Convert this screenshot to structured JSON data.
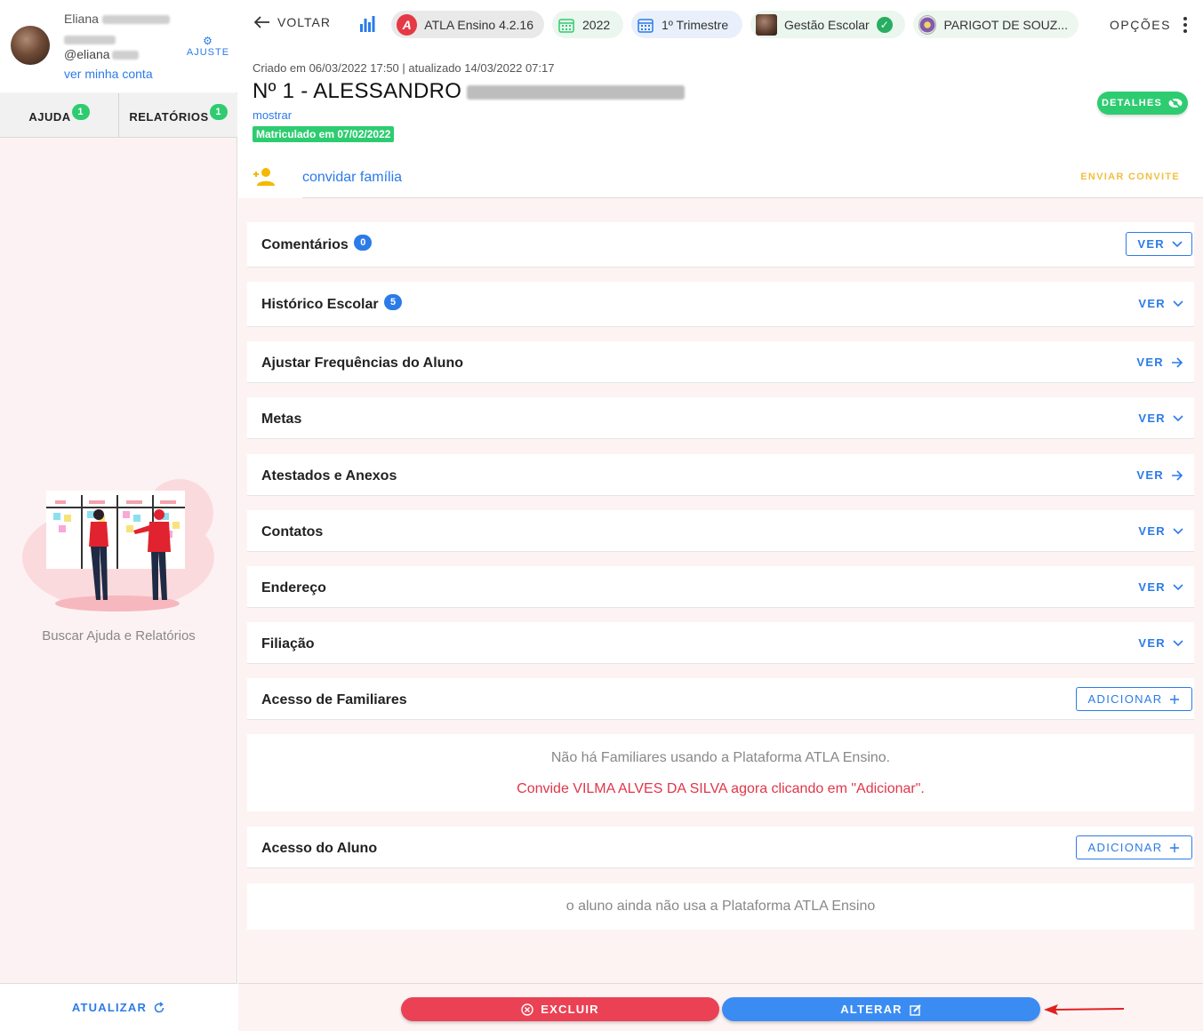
{
  "sidebar": {
    "user": {
      "name": "Eliana",
      "handle": "@eliana",
      "my_account_link": "ver minha conta",
      "adjust_label": "AJUSTE"
    },
    "tabs": [
      {
        "label": "AJUDA",
        "badge": "1"
      },
      {
        "label": "RELATÓRIOS",
        "badge": "1"
      }
    ],
    "help_caption": "Buscar Ajuda e Relatórios",
    "update_label": "ATUALIZAR"
  },
  "topbar": {
    "back_label": "VOLTAR",
    "app_chip": "ATLA Ensino 4.2.16",
    "year_chip": "2022",
    "term_chip": "1º Trimestre",
    "system_chip": "Gestão Escolar",
    "school_chip": "PARIGOT DE SOUZ...",
    "options_label": "OPÇÕES"
  },
  "student": {
    "meta": "Criado em 06/03/2022 17:50 | atualizado 14/03/2022 07:17",
    "title": "Nº 1 - ALESSANDRO",
    "show_link": "mostrar",
    "enrolled": "Matriculado em 07/02/2022",
    "details_label": "DETALHES",
    "invite_family": "convidar família",
    "send_invite": "ENVIAR CONVITE"
  },
  "sections": [
    {
      "title": "Comentários",
      "badge": "0",
      "action": "VER",
      "icon": "chevron-down-icon"
    },
    {
      "title": "Histórico Escolar",
      "badge": "5",
      "action": "VER",
      "icon": "chevron-down-icon"
    },
    {
      "title": "Ajustar Frequências do Aluno",
      "action": "VER",
      "icon": "arrow-right-icon"
    },
    {
      "title": "Metas",
      "action": "VER",
      "icon": "chevron-down-icon"
    },
    {
      "title": "Atestados e Anexos",
      "action": "VER",
      "icon": "arrow-right-icon"
    },
    {
      "title": "Contatos",
      "action": "VER",
      "icon": "chevron-down-icon"
    },
    {
      "title": "Endereço",
      "action": "VER",
      "icon": "chevron-down-icon"
    },
    {
      "title": "Filiação",
      "action": "VER",
      "icon": "chevron-down-icon"
    },
    {
      "title": "Acesso de Familiares",
      "action": "ADICIONAR",
      "icon": "plus-icon"
    },
    {
      "title": "Acesso do Aluno",
      "action": "ADICIONAR",
      "icon": "plus-icon"
    }
  ],
  "family_access": {
    "empty_text": "Não há Familiares usando a Plataforma ATLA Ensino.",
    "invite_text": "Convide VILMA ALVES DA SILVA agora clicando em \"Adicionar\"."
  },
  "student_access": {
    "empty_text": "o aluno ainda não usa a Plataforma ATLA Ensino"
  },
  "actions": {
    "delete_label": "EXCLUIR",
    "edit_label": "ALTERAR"
  },
  "colors": {
    "primary": "#2b7be8",
    "success": "#2ecc71",
    "danger": "#ea4254",
    "warning": "#f0c040",
    "background": "#fdf3f3"
  }
}
